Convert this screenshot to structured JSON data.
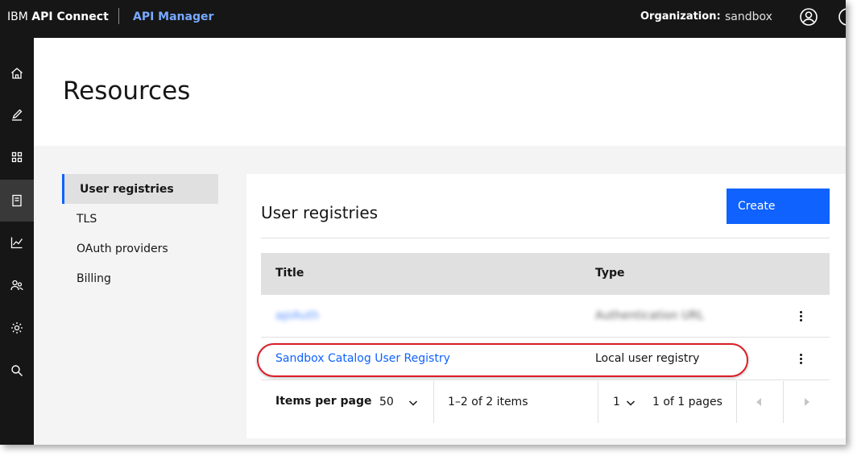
{
  "header": {
    "brand_prefix": "IBM",
    "brand_name": "API Connect",
    "product": "API Manager",
    "org_label": "Organization:",
    "org_value": "sandbox"
  },
  "sidenav": {
    "icons": [
      "home-icon",
      "edit-icon",
      "apps-grid-icon",
      "resources-icon",
      "analytics-icon",
      "members-icon",
      "settings-icon",
      "search-icon"
    ],
    "active_index": 3
  },
  "page": {
    "title": "Resources"
  },
  "menu": {
    "items": [
      {
        "label": "User registries",
        "active": true
      },
      {
        "label": "TLS",
        "active": false
      },
      {
        "label": "OAuth providers",
        "active": false
      },
      {
        "label": "Billing",
        "active": false
      }
    ]
  },
  "card": {
    "title": "User registries",
    "create_label": "Create"
  },
  "table": {
    "columns": [
      "Title",
      "Type"
    ],
    "rows": [
      {
        "title": "apiAuth",
        "type": "Authentication URL",
        "blurred": true
      },
      {
        "title": "Sandbox Catalog User Registry",
        "type": "Local user registry",
        "blurred": false
      }
    ]
  },
  "pager": {
    "items_per_page_label": "Items per page",
    "items_per_page": "50",
    "range": "1–2 of 2 items",
    "page": "1",
    "pages": "1 of 1 pages"
  },
  "colors": {
    "accent": "#0f62fe",
    "topbar": "#161616",
    "highlight": "#da1e28",
    "product": "#78a9ff"
  }
}
